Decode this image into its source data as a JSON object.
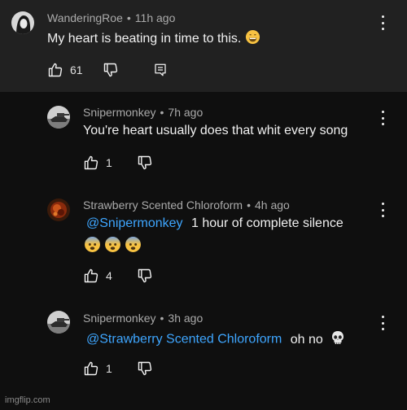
{
  "comments": [
    {
      "author": "WanderingRoe",
      "time": "11h ago",
      "text": "My heart is beating in time to this.",
      "emoji": "grinning-face",
      "likes": "61"
    },
    {
      "author": "Snipermonkey",
      "time": "7h ago",
      "text": "You're heart usually does that whit every song",
      "likes": "1"
    },
    {
      "author": "Strawberry Scented Chloroform",
      "time": "4h ago",
      "mention": "@Snipermonkey",
      "text": "1 hour of complete silence",
      "emoji": "fearful-face",
      "likes": "4"
    },
    {
      "author": "Snipermonkey",
      "time": "3h ago",
      "mention": "@Strawberry Scented Chloroform",
      "text": "oh no",
      "emoji": "skull",
      "likes": "1"
    }
  ],
  "meta_separator": "•",
  "watermark": "imgflip.com",
  "colors": {
    "mention": "#3ea6ff",
    "meta": "#aaaaaa",
    "background": "#0f0f0f",
    "top_block": "#212121"
  }
}
